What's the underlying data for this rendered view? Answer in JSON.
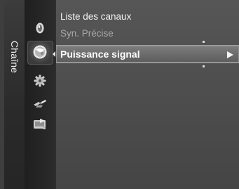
{
  "category": {
    "label": "Chaîne"
  },
  "menu": {
    "items": [
      {
        "label": "Liste des canaux",
        "state": "normal"
      },
      {
        "label": "Syn. Précise",
        "state": "disabled"
      },
      {
        "label": "Puissance signal",
        "state": "selected"
      }
    ]
  },
  "sidebar_icons": [
    {
      "icon": "input-icon",
      "active": false
    },
    {
      "icon": "antenna-dish-icon",
      "active": true
    },
    {
      "icon": "settings-gear-icon",
      "active": false
    },
    {
      "icon": "satellite-icon",
      "active": false
    },
    {
      "icon": "support-icon",
      "active": false
    }
  ],
  "colors": {
    "panel": "#4a4a4a",
    "selected_bg": "#6a6a6a",
    "text": "#f2f2f2",
    "disabled_text": "#a9a9a9"
  }
}
